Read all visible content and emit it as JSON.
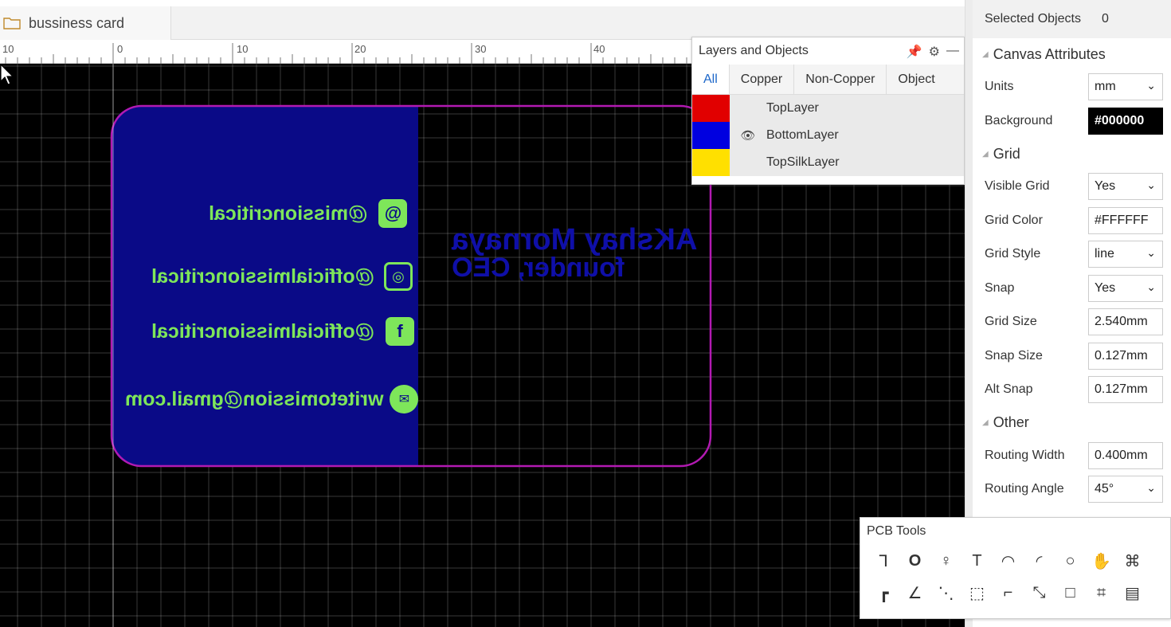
{
  "tab": {
    "title": "bussiness card"
  },
  "ruler": {
    "labels": [
      "10",
      "0",
      "10",
      "20",
      "30",
      "40"
    ]
  },
  "card": {
    "socials": [
      {
        "handle": "@missioncritical",
        "icon": "threads-icon"
      },
      {
        "handle": "@officialmissioncritical",
        "icon": "instagram-icon"
      },
      {
        "handle": "@officialmissioncritical",
        "icon": "facebook-icon"
      },
      {
        "handle": "writetomission@gmail.com",
        "icon": "mail-icon"
      }
    ],
    "name": "AKshay Mornaya",
    "role": "founder, CEO"
  },
  "layers_panel": {
    "title": "Layers and Objects",
    "tabs": [
      "All",
      "Copper",
      "Non-Copper",
      "Object"
    ],
    "active_tab": "All",
    "layers": [
      {
        "name": "TopLayer",
        "color": "#e10000",
        "visible_icon": false
      },
      {
        "name": "BottomLayer",
        "color": "#0000e0",
        "visible_icon": true
      },
      {
        "name": "TopSilkLayer",
        "color": "#ffe000",
        "visible_icon": false
      }
    ]
  },
  "props": {
    "selected_label": "Selected Objects",
    "selected_count": "0",
    "canvas_section": "Canvas Attributes",
    "grid_section": "Grid",
    "other_section": "Other",
    "units_label": "Units",
    "units_value": "mm",
    "background_label": "Background",
    "background_value": "#000000",
    "visible_grid_label": "Visible Grid",
    "visible_grid_value": "Yes",
    "grid_color_label": "Grid Color",
    "grid_color_value": "#FFFFFF",
    "grid_style_label": "Grid Style",
    "grid_style_value": "line",
    "snap_label": "Snap",
    "snap_value": "Yes",
    "grid_size_label": "Grid Size",
    "grid_size_value": "2.540mm",
    "snap_size_label": "Snap Size",
    "snap_size_value": "0.127mm",
    "alt_snap_label": "Alt Snap",
    "alt_snap_value": "0.127mm",
    "routing_width_label": "Routing Width",
    "routing_width_value": "0.400mm",
    "routing_angle_label": "Routing Angle",
    "routing_angle_value": "45°"
  },
  "pcb_tools": {
    "title": "PCB Tools"
  },
  "colors": {
    "card_fill": "#0a0a87",
    "outline": "#b21ab2",
    "silk_green": "#7ee65a"
  }
}
